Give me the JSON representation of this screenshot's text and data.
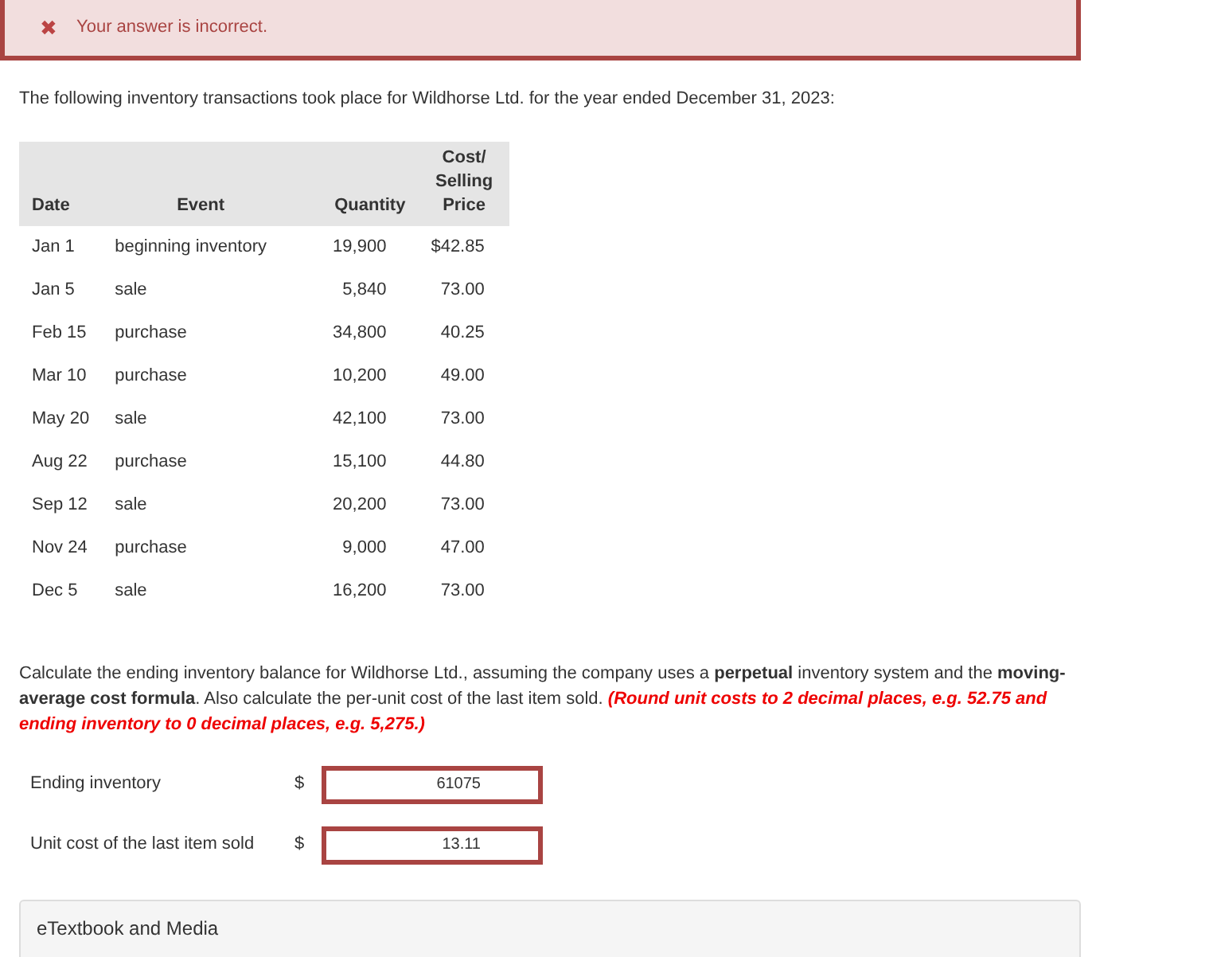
{
  "feedback": {
    "icon": "✖",
    "message": "Your answer is incorrect.",
    "correct": false
  },
  "intro": "The following inventory transactions took place for Wildhorse Ltd. for the year ended December 31, 2023:",
  "table": {
    "columns": [
      "Date",
      "Event",
      "Quantity",
      "Cost/ Selling Price"
    ],
    "rows": [
      [
        "Jan 1",
        "beginning inventory",
        "19,900",
        "$42.85"
      ],
      [
        "Jan 5",
        "sale",
        "5,840",
        "73.00"
      ],
      [
        "Feb 15",
        "purchase",
        "34,800",
        "40.25"
      ],
      [
        "Mar 10",
        "purchase",
        "10,200",
        "49.00"
      ],
      [
        "May 20",
        "sale",
        "42,100",
        "73.00"
      ],
      [
        "Aug 22",
        "purchase",
        "15,100",
        "44.80"
      ],
      [
        "Sep 12",
        "sale",
        "20,200",
        "73.00"
      ],
      [
        "Nov 24",
        "purchase",
        "9,000",
        "47.00"
      ],
      [
        "Dec 5",
        "sale",
        "16,200",
        "73.00"
      ]
    ]
  },
  "question": "Calculate the ending inventory balance for Wildhorse Ltd., assuming the company uses a **perpetual** inventory system and the **moving-average cost formula**. Also calculate the per-unit cost of the last item sold. *(Round unit costs to 2 decimal places, e.g. 52.75 and ending inventory to 0 decimal places, e.g. 5,275.)*",
  "answers": [
    {
      "label": "Ending inventory",
      "currency": "$",
      "value": "61075",
      "incorrect": true
    },
    {
      "label": "Unit cost of the last item sold",
      "currency": "$",
      "value": "13.11",
      "incorrect": true
    }
  ],
  "panel": {
    "title": "eTextbook and Media"
  }
}
